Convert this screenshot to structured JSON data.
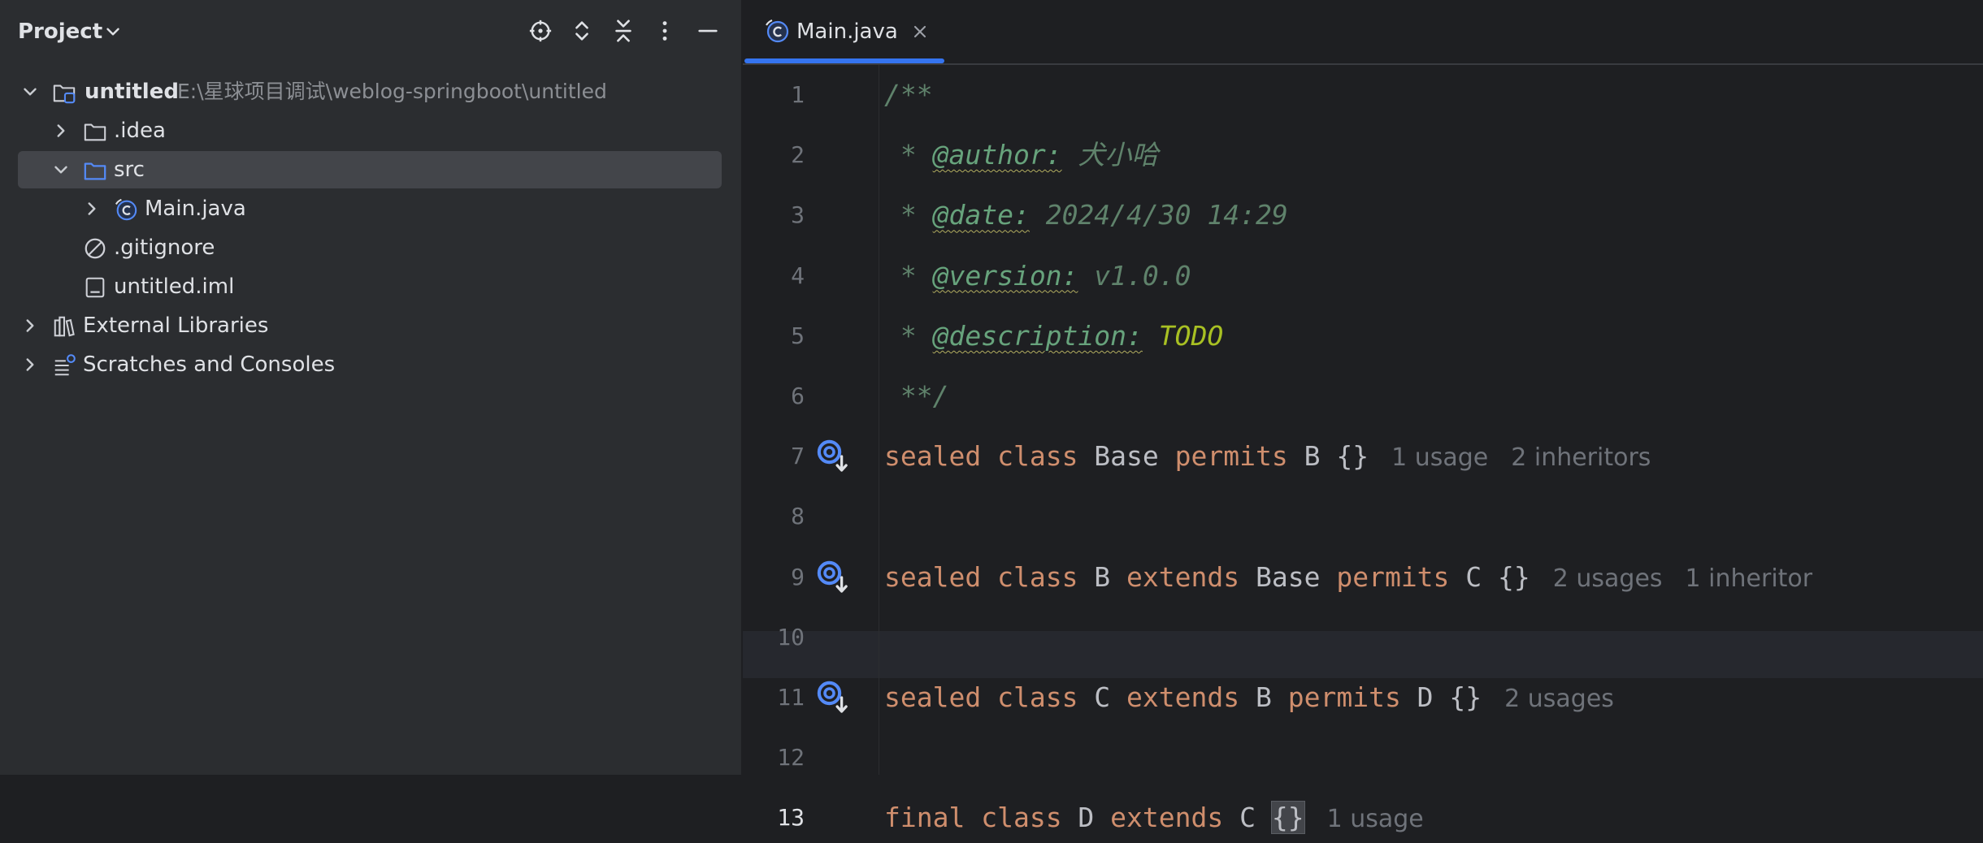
{
  "project_panel": {
    "title": "Project",
    "tree": [
      {
        "label": "untitled",
        "path": "E:\\星球项目调试\\weblog-springboot\\untitled",
        "icon": "module-folder-icon",
        "expanded": true,
        "depth": 0
      },
      {
        "label": ".idea",
        "icon": "folder-icon",
        "expanded": false,
        "depth": 1
      },
      {
        "label": "src",
        "icon": "source-folder-icon",
        "expanded": true,
        "depth": 1,
        "selected": true
      },
      {
        "label": "Main.java",
        "icon": "java-class-icon",
        "expanded": false,
        "depth": 2
      },
      {
        "label": ".gitignore",
        "icon": "gitignore-icon",
        "depth": 1
      },
      {
        "label": "untitled.iml",
        "icon": "iml-file-icon",
        "depth": 1
      },
      {
        "label": "External Libraries",
        "icon": "libraries-icon",
        "expanded": false,
        "depth": 0
      },
      {
        "label": "Scratches and Consoles",
        "icon": "scratches-icon",
        "expanded": false,
        "depth": 0
      }
    ]
  },
  "editor": {
    "tab": {
      "label": "Main.java"
    },
    "current_line": 13,
    "lines": [
      {
        "n": "1",
        "t": [
          {
            "c": "comment",
            "v": "/**"
          }
        ]
      },
      {
        "n": "2",
        "t": [
          {
            "c": "comment",
            "v": " * "
          },
          {
            "c": "tag",
            "v": "@author:"
          },
          {
            "c": "comment",
            "v": " 犬小哈"
          }
        ]
      },
      {
        "n": "3",
        "t": [
          {
            "c": "comment",
            "v": " * "
          },
          {
            "c": "tag",
            "v": "@date:"
          },
          {
            "c": "comment",
            "v": " 2024/4/30 14:29"
          }
        ]
      },
      {
        "n": "4",
        "t": [
          {
            "c": "comment",
            "v": " * "
          },
          {
            "c": "tag",
            "v": "@version:"
          },
          {
            "c": "comment",
            "v": " v1.0.0"
          }
        ]
      },
      {
        "n": "5",
        "t": [
          {
            "c": "comment",
            "v": " * "
          },
          {
            "c": "tag",
            "v": "@description:"
          },
          {
            "c": "todo",
            "v": " TODO"
          }
        ]
      },
      {
        "n": "6",
        "t": [
          {
            "c": "comment",
            "v": " **/"
          }
        ]
      },
      {
        "n": "7",
        "gutter": true,
        "t": [
          {
            "c": "kw",
            "v": "sealed"
          },
          {
            "c": "id",
            "v": " "
          },
          {
            "c": "kw",
            "v": "class"
          },
          {
            "c": "id",
            "v": " Base "
          },
          {
            "c": "kw",
            "v": "permits"
          },
          {
            "c": "id",
            "v": " B {}"
          }
        ],
        "hints": [
          "1 usage",
          "2 inheritors"
        ]
      },
      {
        "n": "8",
        "t": []
      },
      {
        "n": "9",
        "gutter": true,
        "t": [
          {
            "c": "kw",
            "v": "sealed"
          },
          {
            "c": "id",
            "v": " "
          },
          {
            "c": "kw",
            "v": "class"
          },
          {
            "c": "id",
            "v": " B "
          },
          {
            "c": "kw",
            "v": "extends"
          },
          {
            "c": "id",
            "v": " Base "
          },
          {
            "c": "kw",
            "v": "permits"
          },
          {
            "c": "id",
            "v": " C {}"
          }
        ],
        "hints": [
          "2 usages",
          "1 inheritor"
        ]
      },
      {
        "n": "10",
        "t": []
      },
      {
        "n": "11",
        "gutter": true,
        "t": [
          {
            "c": "kw",
            "v": "sealed"
          },
          {
            "c": "id",
            "v": " "
          },
          {
            "c": "kw",
            "v": "class"
          },
          {
            "c": "id",
            "v": " C "
          },
          {
            "c": "kw",
            "v": "extends"
          },
          {
            "c": "id",
            "v": " B "
          },
          {
            "c": "kw",
            "v": "permits"
          },
          {
            "c": "id",
            "v": " D {}"
          }
        ],
        "hints": [
          "2 usages"
        ]
      },
      {
        "n": "12",
        "t": []
      },
      {
        "n": "13",
        "t": [
          {
            "c": "kw",
            "v": "final"
          },
          {
            "c": "id",
            "v": " "
          },
          {
            "c": "kw",
            "v": "class"
          },
          {
            "c": "id",
            "v": " D "
          },
          {
            "c": "kw",
            "v": "extends"
          },
          {
            "c": "id",
            "v": " C "
          },
          {
            "c": "brace",
            "v": "{}"
          }
        ],
        "hints": [
          "1 usage"
        ]
      }
    ]
  },
  "colors": {
    "accent": "#3574f0",
    "keyword": "#cf8e6d",
    "comment": "#5f826b",
    "doc_tag": "#67a37c",
    "todo": "#a8c023",
    "hint": "#6f737a"
  }
}
